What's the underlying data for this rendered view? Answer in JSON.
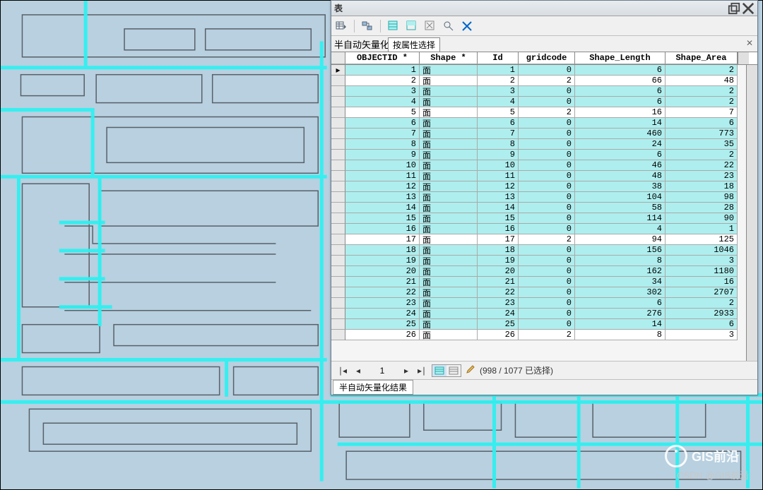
{
  "window": {
    "title": "表"
  },
  "subtitle": {
    "label": "半自动矢量化",
    "popup": "按属性选择"
  },
  "columns": [
    "OBJECTID *",
    "Shape *",
    "Id",
    "gridcode",
    "Shape_Length",
    "Shape_Area"
  ],
  "rows": [
    {
      "oid": 1,
      "shape": "面",
      "id": 1,
      "grid": 0,
      "len": 6,
      "area": 2,
      "sel": true,
      "cursor": true
    },
    {
      "oid": 2,
      "shape": "面",
      "id": 2,
      "grid": 2,
      "len": 66,
      "area": 48,
      "sel": false
    },
    {
      "oid": 3,
      "shape": "面",
      "id": 3,
      "grid": 0,
      "len": 6,
      "area": 2,
      "sel": true
    },
    {
      "oid": 4,
      "shape": "面",
      "id": 4,
      "grid": 0,
      "len": 6,
      "area": 2,
      "sel": true
    },
    {
      "oid": 5,
      "shape": "面",
      "id": 5,
      "grid": 2,
      "len": 16,
      "area": 7,
      "sel": false
    },
    {
      "oid": 6,
      "shape": "面",
      "id": 6,
      "grid": 0,
      "len": 14,
      "area": 6,
      "sel": true
    },
    {
      "oid": 7,
      "shape": "面",
      "id": 7,
      "grid": 0,
      "len": 460,
      "area": 773,
      "sel": true
    },
    {
      "oid": 8,
      "shape": "面",
      "id": 8,
      "grid": 0,
      "len": 24,
      "area": 35,
      "sel": true
    },
    {
      "oid": 9,
      "shape": "面",
      "id": 9,
      "grid": 0,
      "len": 6,
      "area": 2,
      "sel": true
    },
    {
      "oid": 10,
      "shape": "面",
      "id": 10,
      "grid": 0,
      "len": 46,
      "area": 22,
      "sel": true
    },
    {
      "oid": 11,
      "shape": "面",
      "id": 11,
      "grid": 0,
      "len": 48,
      "area": 23,
      "sel": true
    },
    {
      "oid": 12,
      "shape": "面",
      "id": 12,
      "grid": 0,
      "len": 38,
      "area": 18,
      "sel": true
    },
    {
      "oid": 13,
      "shape": "面",
      "id": 13,
      "grid": 0,
      "len": 104,
      "area": 98,
      "sel": true
    },
    {
      "oid": 14,
      "shape": "面",
      "id": 14,
      "grid": 0,
      "len": 58,
      "area": 28,
      "sel": true
    },
    {
      "oid": 15,
      "shape": "面",
      "id": 15,
      "grid": 0,
      "len": 114,
      "area": 90,
      "sel": true
    },
    {
      "oid": 16,
      "shape": "面",
      "id": 16,
      "grid": 0,
      "len": 4,
      "area": 1,
      "sel": true
    },
    {
      "oid": 17,
      "shape": "面",
      "id": 17,
      "grid": 2,
      "len": 94,
      "area": 125,
      "sel": false
    },
    {
      "oid": 18,
      "shape": "面",
      "id": 18,
      "grid": 0,
      "len": 156,
      "area": 1046,
      "sel": true
    },
    {
      "oid": 19,
      "shape": "面",
      "id": 19,
      "grid": 0,
      "len": 8,
      "area": 3,
      "sel": true
    },
    {
      "oid": 20,
      "shape": "面",
      "id": 20,
      "grid": 0,
      "len": 162,
      "area": 1180,
      "sel": true
    },
    {
      "oid": 21,
      "shape": "面",
      "id": 21,
      "grid": 0,
      "len": 34,
      "area": 16,
      "sel": true
    },
    {
      "oid": 22,
      "shape": "面",
      "id": 22,
      "grid": 0,
      "len": 302,
      "area": 2707,
      "sel": true
    },
    {
      "oid": 23,
      "shape": "面",
      "id": 23,
      "grid": 0,
      "len": 6,
      "area": 2,
      "sel": true
    },
    {
      "oid": 24,
      "shape": "面",
      "id": 24,
      "grid": 0,
      "len": 276,
      "area": 2933,
      "sel": true
    },
    {
      "oid": 25,
      "shape": "面",
      "id": 25,
      "grid": 0,
      "len": 14,
      "area": 6,
      "sel": true
    },
    {
      "oid": 26,
      "shape": "面",
      "id": 26,
      "grid": 2,
      "len": 8,
      "area": 3,
      "sel": false
    }
  ],
  "nav": {
    "page": "1",
    "status": "(998 / 1077 已选择)"
  },
  "footer_tab": "半自动矢量化结果",
  "watermark": {
    "brand": "GIS前沿",
    "credit": "CSDN @GIS前沿"
  }
}
